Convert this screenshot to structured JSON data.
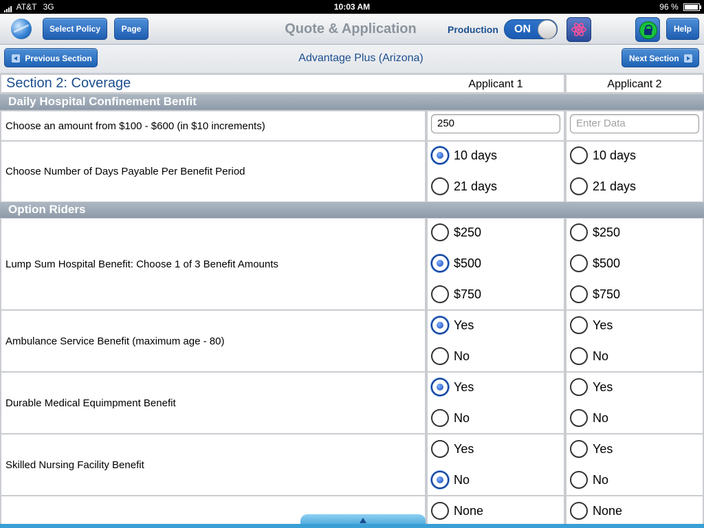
{
  "status_bar": {
    "carrier": "AT&T",
    "network": "3G",
    "time": "10:03 AM",
    "battery_percent": "96 %",
    "battery_level": 0.96
  },
  "toolbar": {
    "select_policy_label": "Select Policy",
    "page_label": "Page",
    "title": "Quote & Application",
    "production_label": "Production",
    "toggle_state": "ON",
    "help_label": "Help",
    "icons": [
      "globe-icon",
      "atom-icon",
      "lock-icon"
    ]
  },
  "nav": {
    "previous_label": "Previous Section",
    "next_label": "Next Section",
    "product_title": "Advantage Plus (Arizona)"
  },
  "form": {
    "section_title": "Section 2:  Coverage",
    "columns": [
      "Applicant 1",
      "Applicant 2"
    ],
    "bands": {
      "daily": "Daily Hospital Confinement Benfit",
      "riders": "Option Riders"
    },
    "amount": {
      "label": "Choose an amount from $100 - $600 (in $10 increments)",
      "applicant1_value": "250",
      "applicant2_placeholder": "Enter Data"
    },
    "days": {
      "label": "Choose Number of Days Payable Per Benefit Period",
      "options": [
        "10 days",
        "21 days"
      ],
      "applicant1_selected": "10 days",
      "applicant2_selected": ""
    },
    "lump_sum": {
      "label": "Lump Sum Hospital Benefit:  Choose 1 of 3 Benefit Amounts",
      "options": [
        "$250",
        "$500",
        "$750"
      ],
      "applicant1_selected": "$500",
      "applicant2_selected": ""
    },
    "ambulance": {
      "label": "Ambulance Service Benefit (maximum age - 80)",
      "options": [
        "Yes",
        "No"
      ],
      "applicant1_selected": "Yes",
      "applicant2_selected": ""
    },
    "dme": {
      "label": "Durable Medical Equimpment Benefit",
      "options": [
        "Yes",
        "No"
      ],
      "applicant1_selected": "Yes",
      "applicant2_selected": ""
    },
    "snf": {
      "label": "Skilled Nursing Facility Benefit",
      "options": [
        "Yes",
        "No"
      ],
      "applicant1_selected": "No",
      "applicant2_selected": ""
    },
    "partial": {
      "label": "",
      "options": [
        "None"
      ],
      "applicant1_selected": "",
      "applicant2_selected": ""
    }
  }
}
